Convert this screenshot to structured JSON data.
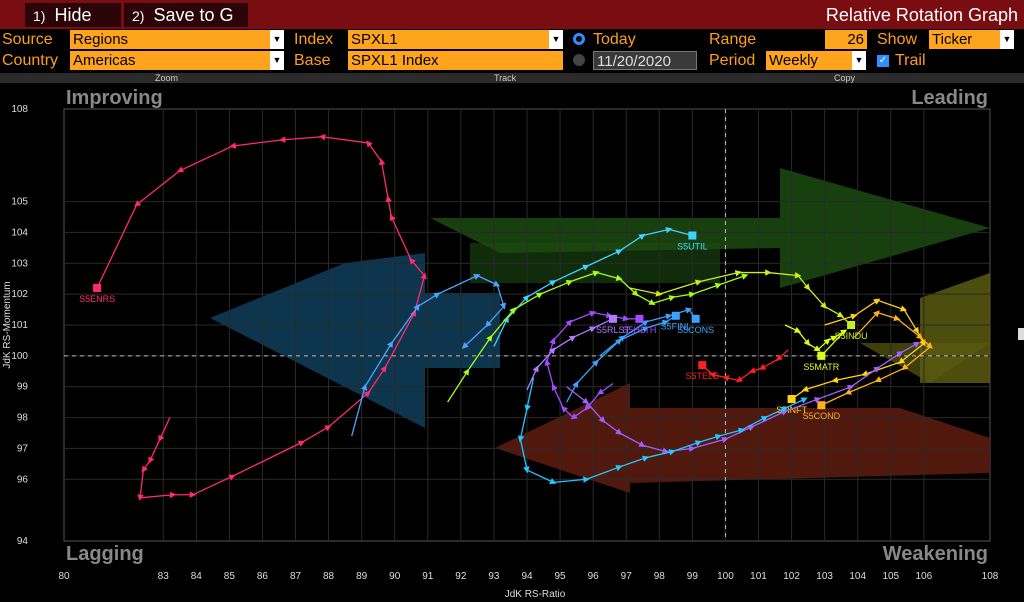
{
  "toolbar": {
    "hide": {
      "num": "1)",
      "label": "Hide"
    },
    "save": {
      "num": "2)",
      "label": "Save to G"
    },
    "title": "Relative Rotation Graph"
  },
  "params": {
    "source_label": "Source",
    "source_value": "Regions",
    "country_label": "Country",
    "country_value": "Americas",
    "index_label": "Index",
    "index_value": "SPXL1",
    "base_label": "Base",
    "base_value": "SPXL1 Index",
    "today_label": "Today",
    "date_value": "11/20/2020",
    "range_label": "Range",
    "range_value": "26",
    "period_label": "Period",
    "period_value": "Weekly",
    "show_label": "Show",
    "show_value": "Ticker",
    "trail_label": "Trail"
  },
  "subbar": {
    "zoom": "Zoom",
    "track": "Track",
    "copy": "Copy"
  },
  "chart_data": {
    "type": "scatter",
    "xlabel": "JdK RS-Ratio",
    "ylabel": "JdK RS-Momentum",
    "xlim": [
      80,
      108
    ],
    "ylim": [
      94,
      108
    ],
    "x_ticks": [
      "80",
      "83",
      "84",
      "85",
      "86",
      "87",
      "88",
      "89",
      "90",
      "91",
      "92",
      "93",
      "94",
      "95",
      "96",
      "97",
      "98",
      "99",
      "100",
      "101",
      "102",
      "103",
      "104",
      "105",
      "106",
      "108"
    ],
    "y_ticks": [
      "108",
      "105",
      "104",
      "103",
      "102",
      "101",
      "100",
      "99",
      "98",
      "97",
      "96",
      "94"
    ],
    "center": [
      100,
      100
    ],
    "quadrants": {
      "top_left": "Improving",
      "top_right": "Leading",
      "bottom_left": "Lagging",
      "bottom_right": "Weakening"
    },
    "quadrant_colors": {
      "top_left": "#0f3a55",
      "top_right": "#1d4a10",
      "bottom_left": "#0f3a55",
      "bottom_right": "#5a1c10"
    },
    "series": [
      {
        "name": "S5ENRS",
        "color": "#ff2a6d",
        "points": [
          [
            83.2,
            98.0
          ],
          [
            82.9,
            97.3
          ],
          [
            82.6,
            96.6
          ],
          [
            82.4,
            96.3
          ],
          [
            82.3,
            95.4
          ],
          [
            83.3,
            95.5
          ],
          [
            83.9,
            95.5
          ],
          [
            85.1,
            96.1
          ],
          [
            87.2,
            97.2
          ],
          [
            88.0,
            97.7
          ],
          [
            89.2,
            98.8
          ],
          [
            89.7,
            99.6
          ],
          [
            90.6,
            101.4
          ],
          [
            90.9,
            102.6
          ],
          [
            90.5,
            103.1
          ],
          [
            89.9,
            104.5
          ],
          [
            89.8,
            105.1
          ],
          [
            89.6,
            106.3
          ],
          [
            89.2,
            106.9
          ],
          [
            87.8,
            107.1
          ],
          [
            86.6,
            107.0
          ],
          [
            85.1,
            106.8
          ],
          [
            83.5,
            106.0
          ],
          [
            82.2,
            104.9
          ],
          [
            81.0,
            102.2
          ]
        ],
        "end_marker": true
      },
      {
        "name": "",
        "color": "#4aa3ff",
        "points": [
          [
            88.7,
            97.4
          ],
          [
            89.1,
            99.0
          ],
          [
            89.9,
            100.4
          ],
          [
            90.7,
            101.6
          ],
          [
            91.3,
            102.0
          ],
          [
            92.5,
            102.6
          ],
          [
            93.1,
            102.3
          ],
          [
            93.3,
            101.6
          ],
          [
            92.8,
            101.0
          ],
          [
            92.1,
            100.3
          ]
        ],
        "end_marker": false
      },
      {
        "name": "S5UTIL",
        "color": "#3fd3ff",
        "points": [
          [
            93.0,
            100.3
          ],
          [
            93.4,
            101.2
          ],
          [
            94.0,
            101.9
          ],
          [
            94.8,
            102.4
          ],
          [
            95.8,
            102.9
          ],
          [
            96.8,
            103.4
          ],
          [
            97.5,
            103.9
          ],
          [
            98.3,
            104.1
          ],
          [
            99.0,
            103.9
          ]
        ],
        "end_marker": true
      },
      {
        "name": "S5FINL",
        "color": "#3aa3ff",
        "points": [
          [
            95.2,
            98.5
          ],
          [
            95.5,
            99.1
          ],
          [
            96.1,
            99.8
          ],
          [
            96.8,
            100.5
          ],
          [
            97.6,
            100.9
          ],
          [
            98.2,
            101.1
          ],
          [
            98.5,
            101.3
          ]
        ],
        "end_marker": true
      },
      {
        "name": "S5CONS",
        "color": "#3aa3ff",
        "points": [
          [
            96.2,
            100.0
          ],
          [
            96.9,
            100.6
          ],
          [
            97.6,
            101.1
          ],
          [
            98.3,
            101.3
          ],
          [
            98.9,
            101.5
          ],
          [
            99.1,
            101.2
          ]
        ],
        "end_marker": true
      },
      {
        "name": "S5HLTH",
        "color": "#a24cff",
        "points": [
          [
            96.6,
            99.1
          ],
          [
            96.2,
            98.8
          ],
          [
            95.8,
            98.3
          ],
          [
            95.4,
            98.0
          ],
          [
            95.1,
            98.3
          ],
          [
            94.8,
            99.0
          ],
          [
            94.6,
            99.8
          ],
          [
            94.8,
            100.5
          ],
          [
            95.3,
            101.1
          ],
          [
            96.0,
            101.4
          ],
          [
            96.5,
            101.3
          ],
          [
            97.0,
            101.2
          ],
          [
            97.4,
            101.2
          ]
        ],
        "end_marker": true
      },
      {
        "name": "S5RLST",
        "color": "#b07bff",
        "points": [
          [
            94.0,
            98.9
          ],
          [
            94.3,
            99.6
          ],
          [
            94.8,
            100.2
          ],
          [
            95.4,
            100.6
          ],
          [
            96.0,
            100.9
          ],
          [
            96.6,
            101.2
          ]
        ],
        "end_marker": true
      },
      {
        "name": "",
        "color": "#a0ff1a",
        "points": [
          [
            91.6,
            98.5
          ],
          [
            92.2,
            99.5
          ],
          [
            92.9,
            100.6
          ],
          [
            93.6,
            101.5
          ],
          [
            94.4,
            102.0
          ],
          [
            95.3,
            102.4
          ],
          [
            96.1,
            102.7
          ],
          [
            96.8,
            102.5
          ],
          [
            97.3,
            102.0
          ],
          [
            97.8,
            101.7
          ],
          [
            98.4,
            101.9
          ],
          [
            99.0,
            102.0
          ],
          [
            99.8,
            102.3
          ],
          [
            100.6,
            102.6
          ]
        ],
        "end_marker": false
      },
      {
        "name": "S5INDU",
        "color": "#c9f01a",
        "points": [
          [
            97.1,
            102.2
          ],
          [
            98.0,
            102.0
          ],
          [
            99.2,
            102.4
          ],
          [
            100.4,
            102.7
          ],
          [
            101.3,
            102.7
          ],
          [
            102.2,
            102.6
          ],
          [
            102.5,
            102.2
          ],
          [
            103.0,
            101.6
          ],
          [
            103.5,
            101.3
          ],
          [
            103.8,
            101.0
          ]
        ],
        "end_marker": true
      },
      {
        "name": "S5MATR",
        "color": "#d8ff1a",
        "points": [
          [
            101.8,
            101.0
          ],
          [
            102.2,
            100.8
          ],
          [
            102.5,
            100.4
          ],
          [
            102.8,
            100.2
          ],
          [
            103.1,
            100.5
          ],
          [
            103.3,
            100.6
          ],
          [
            103.6,
            100.8
          ],
          [
            102.9,
            100.0
          ]
        ],
        "end_marker": true
      },
      {
        "name": "S5TELS",
        "color": "#ff2020",
        "points": [
          [
            101.9,
            100.2
          ],
          [
            101.6,
            99.9
          ],
          [
            101.1,
            99.6
          ],
          [
            100.8,
            99.5
          ],
          [
            100.4,
            99.2
          ],
          [
            100.0,
            99.3
          ],
          [
            99.6,
            99.4
          ],
          [
            99.3,
            99.7
          ]
        ],
        "end_marker": true
      },
      {
        "name": "S5INFT",
        "color": "#ffd21a",
        "points": [
          [
            103.0,
            101.0
          ],
          [
            103.9,
            101.3
          ],
          [
            104.6,
            101.8
          ],
          [
            105.4,
            101.5
          ],
          [
            105.8,
            100.8
          ],
          [
            106.0,
            100.4
          ],
          [
            105.3,
            99.8
          ],
          [
            104.2,
            99.4
          ],
          [
            103.3,
            99.2
          ],
          [
            102.4,
            98.9
          ],
          [
            102.0,
            98.6
          ]
        ],
        "end_marker": true
      },
      {
        "name": "S5COND",
        "color": "#ffb01a",
        "points": [
          [
            103.9,
            100.6
          ],
          [
            104.6,
            101.4
          ],
          [
            105.2,
            101.2
          ],
          [
            105.9,
            100.6
          ],
          [
            106.2,
            100.3
          ],
          [
            105.4,
            99.6
          ],
          [
            104.6,
            99.2
          ],
          [
            103.7,
            98.8
          ],
          [
            102.9,
            98.4
          ]
        ],
        "end_marker": true
      },
      {
        "name": "",
        "color": "#a060ff",
        "points": [
          [
            95.2,
            99.0
          ],
          [
            95.8,
            98.5
          ],
          [
            96.3,
            97.9
          ],
          [
            96.8,
            97.5
          ],
          [
            97.5,
            97.1
          ],
          [
            98.2,
            96.9
          ],
          [
            99.0,
            97.0
          ],
          [
            100.0,
            97.3
          ],
          [
            100.8,
            97.7
          ],
          [
            101.8,
            98.2
          ],
          [
            102.8,
            98.6
          ],
          [
            103.8,
            99.0
          ],
          [
            104.6,
            99.6
          ],
          [
            105.3,
            100.1
          ],
          [
            105.8,
            100.4
          ]
        ],
        "end_marker": false
      },
      {
        "name": "",
        "color": "#23c6ff",
        "points": [
          [
            94.2,
            99.3
          ],
          [
            94.0,
            98.3
          ],
          [
            93.8,
            97.3
          ],
          [
            94.0,
            96.3
          ],
          [
            94.8,
            95.9
          ],
          [
            95.8,
            96.0
          ],
          [
            96.8,
            96.4
          ],
          [
            97.6,
            96.7
          ],
          [
            98.4,
            96.9
          ],
          [
            99.2,
            97.2
          ],
          [
            99.8,
            97.4
          ],
          [
            100.5,
            97.6
          ],
          [
            101.2,
            98.0
          ],
          [
            101.8,
            98.3
          ],
          [
            102.4,
            98.6
          ]
        ],
        "end_marker": false
      }
    ]
  }
}
